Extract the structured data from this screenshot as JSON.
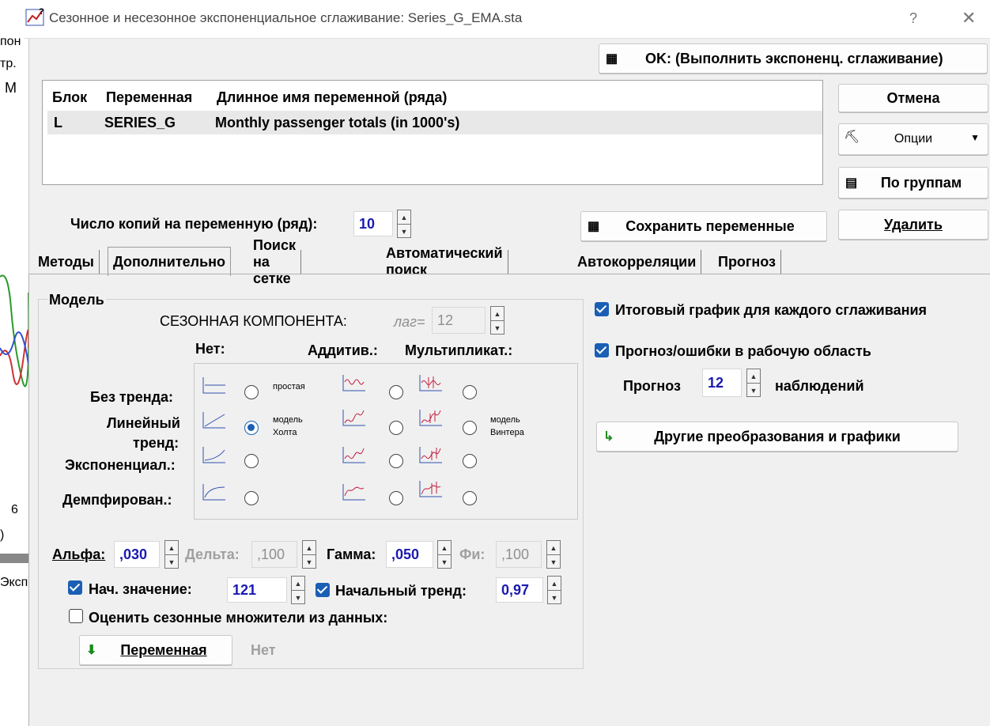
{
  "window": {
    "title": "Сезонное и несезонное экспоненциальное сглаживание: Series_G_EMA.sta",
    "help": "?",
    "close": "✕"
  },
  "background_app": {
    "lines": [
      "пон",
      "тр.",
      "M",
      "6",
      ")",
      "Эксп"
    ]
  },
  "buttons": {
    "ok": "OK: (Выполнить экспоненц. сглаживание)",
    "cancel": "Отмена",
    "options": "Опции",
    "by_groups": "По группам",
    "delete": "Удалить",
    "save_vars": "Сохранить переменные",
    "other_transforms": "Другие преобразования и графики",
    "variable": "Переменная"
  },
  "var_table": {
    "headers": [
      "Блок",
      "Переменная",
      "Длинное имя переменной (ряда)"
    ],
    "rows": [
      [
        "L",
        "SERIES_G",
        "Monthly passenger totals (in 1000's)"
      ]
    ]
  },
  "copies": {
    "label": "Число копий на переменную (ряд):",
    "value": "10"
  },
  "tabs": [
    "Методы",
    "Дополнительно",
    "Поиск на сетке",
    "Автоматический поиск",
    "Автокорреляции",
    "Прогноз"
  ],
  "model": {
    "group_title": "Модель",
    "seasonal_label": "СЕЗОННАЯ КОМПОНЕНТА:",
    "lag_label": "лаг=",
    "lag_value": "12",
    "col_none": "Нет:",
    "col_additive": "Аддитив.:",
    "col_mult": "Мультипликат.:",
    "row_no_trend": "Без тренда:",
    "row_linear": "Линейный",
    "row_linear2": "тренд:",
    "row_exp": "Экспоненциал.:",
    "row_damped": "Демпфирован.:",
    "simple": "простая",
    "holt1": "модель",
    "holt2": "Холта",
    "winters1": "модель",
    "winters2": "Винтера"
  },
  "params": {
    "alpha_label": "Альфа:",
    "alpha": ",030",
    "delta_label": "Дельта:",
    "delta": ",100",
    "gamma_label": "Гамма:",
    "gamma": ",050",
    "phi_label": "Фи:",
    "phi": ",100"
  },
  "init": {
    "init_value_label": "Нач. значение:",
    "init_value": "121",
    "init_trend_label": "Начальный тренд:",
    "init_trend": "0,97",
    "estimate_label": "Оценить сезонные множители из данных:",
    "none": "Нет"
  },
  "right": {
    "final_graph": "Итоговый график для каждого сглаживания",
    "forecast_errors": "Прогноз/ошибки в рабочую область",
    "forecast_label": "Прогноз",
    "forecast_value": "12",
    "observations": "наблюдений"
  }
}
